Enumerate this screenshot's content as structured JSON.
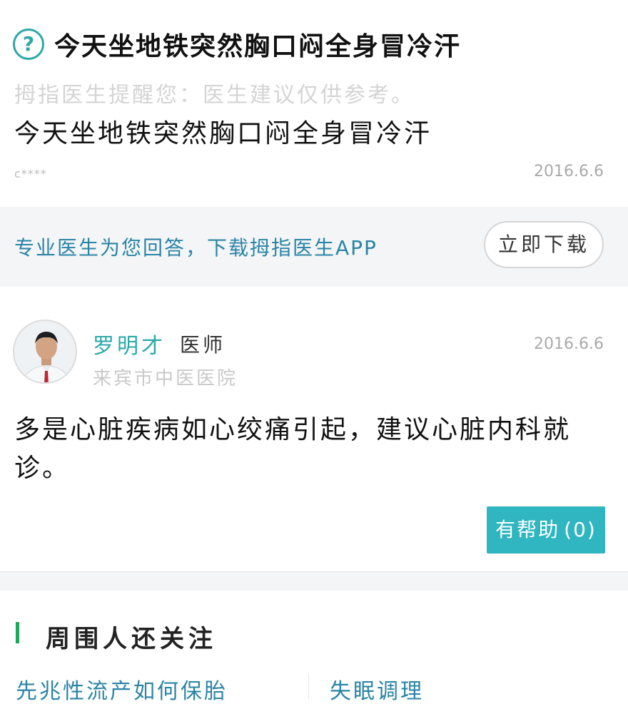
{
  "question": {
    "title": "今天坐地铁突然胸口闷全身冒冷汗",
    "notice": "拇指医生提醒您：医生建议仅供参考。",
    "body": "今天坐地铁突然胸口闷全身冒冷汗",
    "user": "c****",
    "date": "2016.6.6",
    "icon": "question-circle-icon",
    "accent_color": "#2aa9a7"
  },
  "promo": {
    "text": "专业医生为您回答，下载拇指医生APP",
    "download_label": "立即下载"
  },
  "answer": {
    "doctor_name": "罗明才",
    "doctor_role": "医师",
    "hospital": "来宾市中医医院",
    "date": "2016.6.6",
    "body": "多是心脏疾病如心绞痛引起，建议心脏内科就诊。",
    "helpful_label": "有帮助",
    "helpful_count": "(0)",
    "button_color": "#2fb6c0"
  },
  "related": {
    "title": "周围人还关注",
    "links": [
      "先兆性流产如何保胎",
      "失眠调理"
    ],
    "bar_color": "#20a85a"
  }
}
